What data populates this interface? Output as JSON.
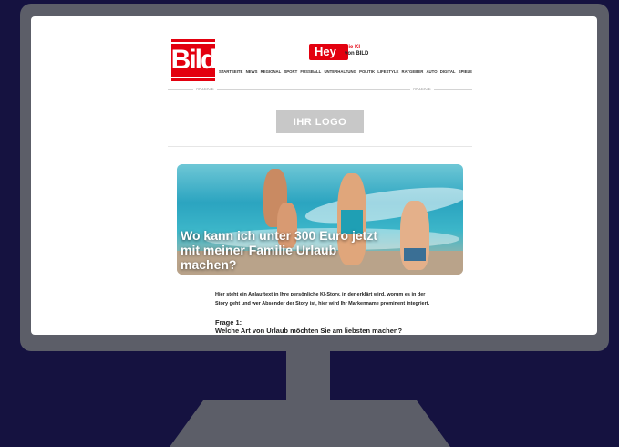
{
  "header": {
    "bild_logo": "Bild",
    "hey_label": "Hey_",
    "hey_sub_line1": "Die KI",
    "hey_sub_line2": "von BILD"
  },
  "nav": {
    "items": [
      "STARTSEITE",
      "NEWS",
      "REGIONAL",
      "SPORT",
      "FUSSBALL",
      "UNTERHALTUNG",
      "POLITIK",
      "LIFESTYLE",
      "RATGEBER",
      "AUTO",
      "DIGITAL",
      "SPIELE"
    ]
  },
  "ad": {
    "left_label": "ANZEIGE",
    "right_label": "ANZEIGE",
    "logo_placeholder": "IHR LOGO"
  },
  "story": {
    "title": "Wo kann ich unter 300 Euro jetzt mit meiner Familie Urlaub machen?",
    "intro": "Hier steht ein Anlauftext in Ihre persönliche KI-Story, in der erklärt wird, worum es in der Story geht und wer Absender der Story ist, hier wird Ihr Markenname prominent integriert.",
    "question_label": "Frage 1:",
    "question_text": "Welche Art von Urlaub möchten Sie am liebsten machen?"
  },
  "colors": {
    "brand_red": "#e3000f",
    "background": "#151240",
    "monitor": "#5c5e68"
  }
}
